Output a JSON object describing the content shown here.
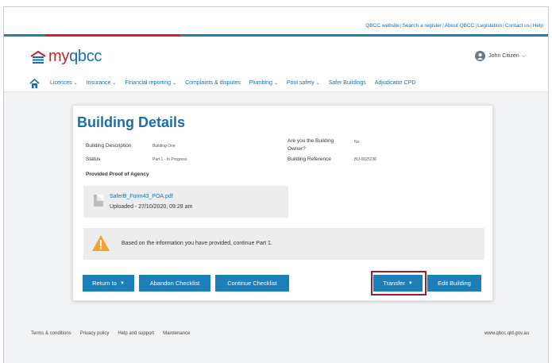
{
  "util_links": [
    "QBCC website",
    "Search a register",
    "About QBCC",
    "Legislation",
    "Contact us",
    "Help"
  ],
  "brand": {
    "prefix": "my",
    "name": "qbcc",
    "primary_color": "#1b6fa9",
    "accent_color": "#c8232c"
  },
  "user": {
    "name": "John Citizen"
  },
  "nav": [
    "Licences",
    "Insurance",
    "Financial reporting",
    "Complaints & disputes",
    "Plumbing",
    "Pool safety",
    "Safer Buildings",
    "Adjudicator CPD"
  ],
  "card": {
    "title": "Building Details",
    "fields": {
      "description_label": "Building Description",
      "description_value": "Building One",
      "status_label": "Status",
      "status_value": "Part 1 - In Progress",
      "owner_label_1": "Are you the Building",
      "owner_label_2": "Owner?",
      "owner_value": "No",
      "reference_label": "Building Reference",
      "reference_value": "BU-0025236"
    },
    "proof_title": "Provided Proof of Agency",
    "file": {
      "name": "SaferB_Form43_POA.pdf",
      "uploaded": "Uploaded - 27/10/2020, 09:28 am"
    },
    "alert_text": "Based on the information you have provided, continue Part 1.",
    "buttons": {
      "return": "Return to",
      "abandon": "Abandon Checklist",
      "continue": "Continue Checklist",
      "transfer": "Transfer",
      "edit": "Edit Building"
    }
  },
  "footer": {
    "links": [
      "Terms & conditions",
      "Privacy policy",
      "Help and support",
      "Maintenance"
    ],
    "site": "www.qbcc.qld.gov.au"
  }
}
